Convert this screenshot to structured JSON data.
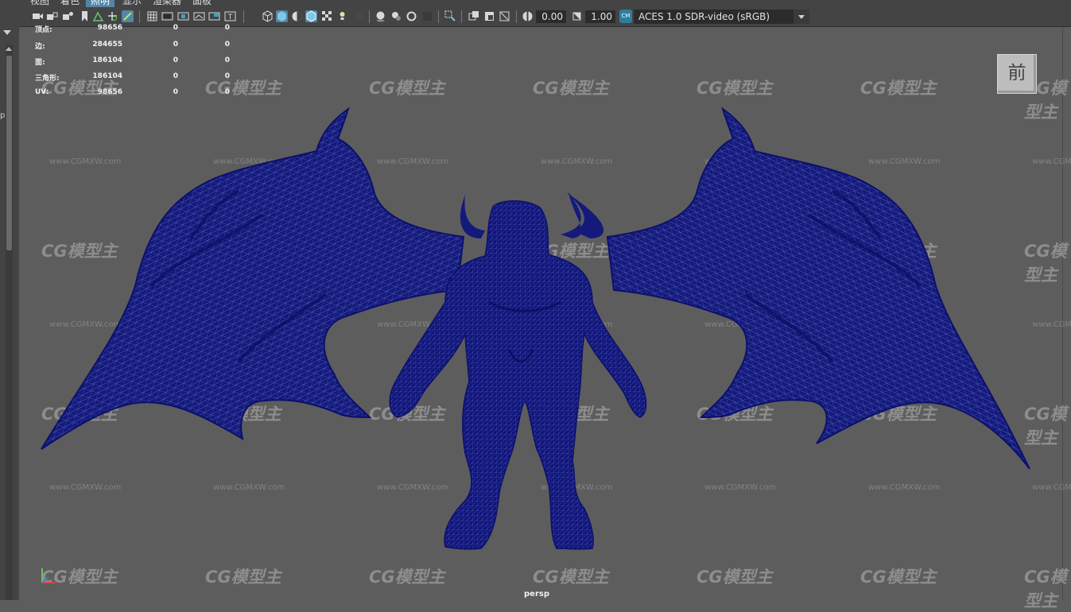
{
  "menubar": {
    "items": [
      "视图",
      "着色",
      "照明",
      "显示",
      "渲染器",
      "面板"
    ],
    "active_index": 2
  },
  "toolbar": {
    "icons": [
      "camera-icon",
      "camera-lock-icon",
      "camera-attrs-icon",
      "bookmark-icon",
      "image-plane-icon",
      "grid-2d-icon",
      "grease-pencil-icon",
      "grid-icon",
      "film-gate-icon",
      "resolution-gate-icon",
      "gate-mask-icon",
      "field-chart-icon",
      "safe-action-icon",
      "wireframe-icon",
      "smooth-shade-icon",
      "shade-all-icon",
      "wireframe-on-shaded-icon",
      "xray-icon",
      "textured-icon",
      "lights-icon",
      "shadows-icon",
      "ambient-occlusion-icon",
      "motion-blur-icon",
      "anti-alias-icon",
      "depth-of-field-icon",
      "isolate-select-icon",
      "xray-joints-icon",
      "xray-active-icon",
      "backface-icon",
      "exposure-icon",
      "gamma-icon"
    ],
    "exposure": "0.00",
    "gamma": "1.00",
    "color_badge": "CM",
    "color_management": "ACES 1.0 SDR-video (sRGB)"
  },
  "hud": {
    "rows": [
      {
        "label": "顶点:",
        "v1": "98656",
        "v2": "0",
        "v3": "0"
      },
      {
        "label": "边:",
        "v1": "284655",
        "v2": "0",
        "v3": "0"
      },
      {
        "label": "面:",
        "v1": "186104",
        "v2": "0",
        "v3": "0"
      },
      {
        "label": "三角形:",
        "v1": "186104",
        "v2": "0",
        "v3": "0"
      },
      {
        "label": "UV:",
        "v1": "98656",
        "v2": "0",
        "v3": "0"
      }
    ]
  },
  "viewcube": {
    "label": "前"
  },
  "camera": {
    "name": "persp"
  },
  "watermark": {
    "logo": "CG模型主",
    "url": "www.CGMXW.com"
  },
  "side_panel": {
    "cut_text": "p"
  },
  "colors": {
    "background": "#5d5d5d",
    "mesh": "#141a7c",
    "mesh_line": "#6c76c4",
    "panel": "#444444",
    "highlight": "#5285a6"
  }
}
